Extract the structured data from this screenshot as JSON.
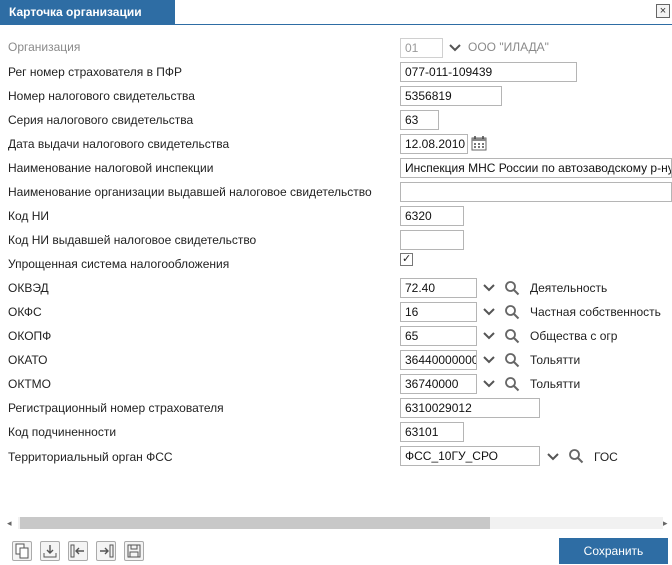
{
  "tab": {
    "title": "Карточка организации",
    "close": "×"
  },
  "form": {
    "org": {
      "label": "Организация",
      "code": "01",
      "name": "ООО \"ИЛАДА\""
    },
    "pfr": {
      "label": "Рег номер страхователя в ПФР",
      "value": "077-011-109439"
    },
    "tax_num": {
      "label": "Номер налогового свидетельства",
      "value": "5356819"
    },
    "tax_ser": {
      "label": "Серия налогового свидетельства",
      "value": "63"
    },
    "tax_date": {
      "label": "Дата выдачи налогового свидетельства",
      "value": "12.08.2010"
    },
    "inspect": {
      "label": "Наименование налоговой инспекции",
      "value": "Инспекция МНС России по автозаводскому р-ну"
    },
    "issuer": {
      "label": "Наименование организации выдавшей налоговое свидетельство",
      "value": ""
    },
    "ni": {
      "label": "Код НИ",
      "value": "6320"
    },
    "ni_issuer": {
      "label": "Код НИ выдавшей налоговое свидетельство",
      "value": ""
    },
    "usn": {
      "label": "Упрощенная система налогообложения",
      "checked": true,
      "check": "✓"
    },
    "okved": {
      "label": "ОКВЭД",
      "value": "72.40",
      "desc": "Деятельность"
    },
    "okfs": {
      "label": "ОКФС",
      "value": "16",
      "desc": "Частная собственность"
    },
    "okopf": {
      "label": "ОКОПФ",
      "value": "65",
      "desc": "Общества с огр"
    },
    "okato": {
      "label": "ОКАТО",
      "value": "36440000000",
      "desc": "Тольятти"
    },
    "oktmo": {
      "label": "ОКТМО",
      "value": "36740000",
      "desc": "Тольятти"
    },
    "reg_num": {
      "label": "Регистрационный номер страхователя",
      "value": "6310029012"
    },
    "sub_code": {
      "label": "Код подчиненности",
      "value": "63101"
    },
    "fss": {
      "label": "Территориальный орган ФСС",
      "value": "ФСС_10ГУ_СРО",
      "desc": "ГОС"
    }
  },
  "scroll": {
    "left": "◂",
    "right": "▸"
  },
  "buttons": {
    "save": "Сохранить"
  }
}
